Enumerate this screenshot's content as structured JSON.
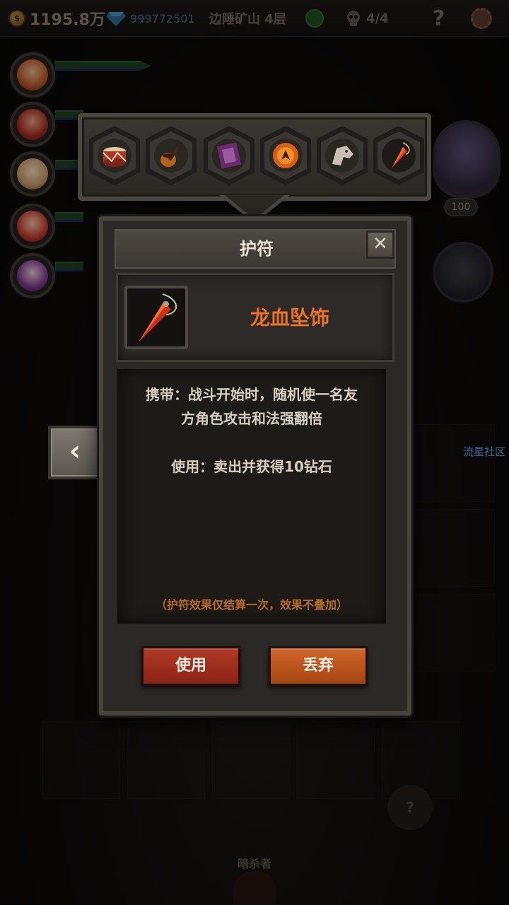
{
  "topbar": {
    "gold_icon_glyph": "$",
    "gold": "1195.8万",
    "gems": "999772501",
    "floor": "边陲矿山 4层",
    "skull_count": "4/4",
    "help": "?"
  },
  "right_panel": {
    "angel_count": "100",
    "community_link": "流星社区"
  },
  "background": {
    "assassin_label": "暗杀者",
    "hint_mark": "?"
  },
  "amulets": {
    "slots": [
      {
        "name": "drum-amulet"
      },
      {
        "name": "pipe-amulet"
      },
      {
        "name": "tome-amulet"
      },
      {
        "name": "phoenix-orb-amulet"
      },
      {
        "name": "beast-head-amulet"
      },
      {
        "name": "dragon-blood-pendant-amulet"
      }
    ]
  },
  "dialog": {
    "title": "护符",
    "close": "✕",
    "item_name": "龙血坠饰",
    "desc_line1": "携带：战斗开始时，随机使一名友",
    "desc_line2": "方角色攻击和法强翻倍",
    "use_line": "使用：卖出并获得10钻石",
    "note": "（护符效果仅结算一次，效果不叠加）",
    "use_button": "使用",
    "discard_button": "丢弃",
    "back": "‹"
  },
  "colors": {
    "item_name": "#e8722a",
    "note": "#b56a2a",
    "use_button": "#b13a26",
    "discard_button": "#d0662a",
    "community_link": "#4aa6e6"
  }
}
